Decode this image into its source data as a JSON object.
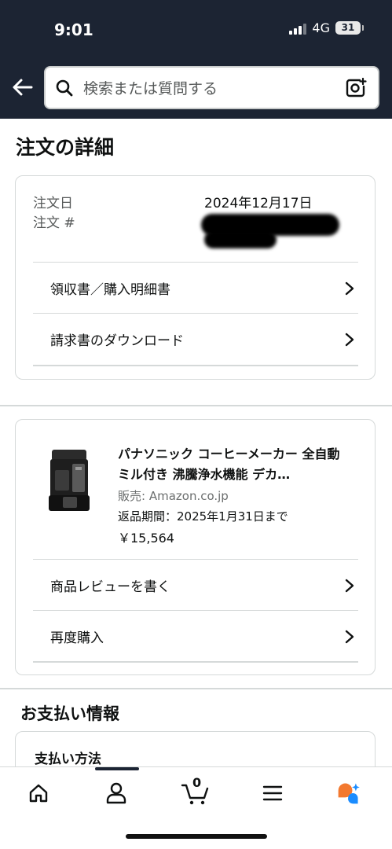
{
  "status_bar": {
    "time": "9:01",
    "network": "4G",
    "battery": "31"
  },
  "search": {
    "placeholder": "検索または質問する"
  },
  "page": {
    "title": "注文の詳細"
  },
  "order_summary": {
    "date_label": "注文日",
    "date_value": "2024年12月17日",
    "number_label": "注文 #",
    "links": [
      {
        "label": "領収書／購入明細書"
      },
      {
        "label": "請求書のダウンロード"
      }
    ]
  },
  "item": {
    "title": "パナソニック コーヒーメーカー 全自動 ミル付き 沸騰浄水機能 デカ…",
    "seller": "販売: Amazon.co.jp",
    "return_period": "返品期間：2025年1月31日まで",
    "price": "￥15,564",
    "links": [
      {
        "label": "商品レビューを書く"
      },
      {
        "label": "再度購入"
      }
    ]
  },
  "payment": {
    "section_title": "お支払い情報",
    "method_label": "支払い方法"
  },
  "bottom_nav": {
    "cart_count": "0",
    "items": [
      {
        "icon": "home-icon"
      },
      {
        "icon": "account-icon"
      },
      {
        "icon": "cart-icon"
      },
      {
        "icon": "menu-icon"
      },
      {
        "icon": "rufus-assistant-icon"
      }
    ]
  },
  "colors": {
    "header_bg": "#1c2433",
    "assistant_orange": "#f3792f",
    "assistant_blue": "#1a8cff"
  }
}
